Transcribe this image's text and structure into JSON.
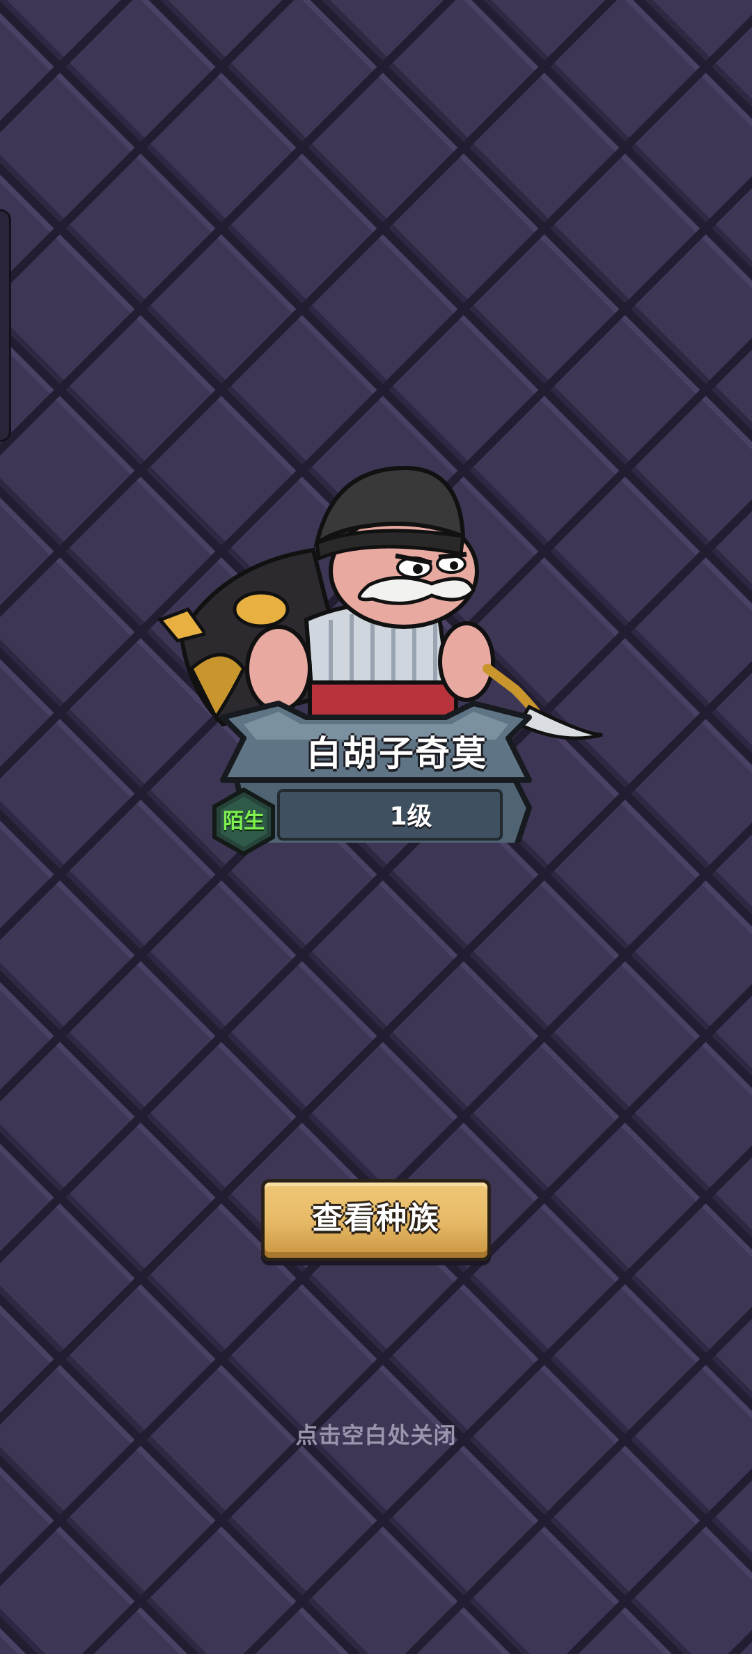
{
  "hero": {
    "name": "白胡子奇莫",
    "rarity": "陌生",
    "level": "1级",
    "portrait_icon": "pirate-captain-character"
  },
  "actions": {
    "view_race_label": "查看种族"
  },
  "hint": {
    "close_text": "点击空白处关闭"
  },
  "colors": {
    "background": "#3b3350",
    "tile_light": "#3f3756",
    "tile_dark": "#28223a",
    "button_gold": "#e5b865",
    "rarity_green": "#7ff04e",
    "nameplate_steel": "#5f7585"
  }
}
